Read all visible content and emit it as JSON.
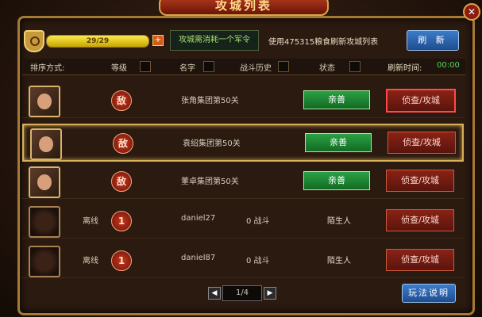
{
  "window": {
    "title": "攻城列表",
    "close_icon": "close-icon"
  },
  "top": {
    "energy_text": "29/29",
    "energy_ratio": 1.0,
    "notice": "攻城需消耗一个军令",
    "refresh_tip": "使用475315粮食刷新攻城列表",
    "refresh_button": "刷 新"
  },
  "sort": {
    "label": "排序方式:",
    "level": "等级",
    "name": "名字",
    "history": "战斗历史",
    "status": "状态",
    "refresh_time_label": "刷新时间:",
    "refresh_time": "00:00"
  },
  "rows": [
    {
      "enemy": "敌",
      "name": "张角集团第50关",
      "relation_btn": "亲善",
      "attack_btn": "侦查/攻城"
    },
    {
      "enemy": "敌",
      "name": "袁绍集团第50关",
      "relation_btn": "亲善",
      "attack_btn": "侦查/攻城"
    },
    {
      "enemy": "敌",
      "name": "董卓集团第50关",
      "relation_btn": "亲善",
      "attack_btn": "侦查/攻城"
    },
    {
      "status": "离线",
      "level": "1",
      "name": "daniel27",
      "battle": "0 战斗",
      "relation": "陌生人",
      "attack_btn": "侦查/攻城"
    },
    {
      "status": "离线",
      "level": "1",
      "name": "daniel87",
      "battle": "0 战斗",
      "relation": "陌生人",
      "attack_btn": "侦查/攻城"
    }
  ],
  "pager": {
    "page": "1/4",
    "prev": "◀",
    "next": "▶"
  },
  "help_button": "玩法说明"
}
